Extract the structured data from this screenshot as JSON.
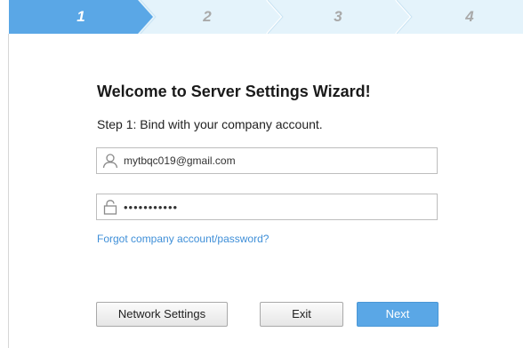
{
  "wizard": {
    "steps": [
      {
        "label": "1",
        "active": true
      },
      {
        "label": "2",
        "active": false
      },
      {
        "label": "3",
        "active": false
      },
      {
        "label": "4",
        "active": false
      }
    ],
    "colors": {
      "active_step": "#5aa7e6",
      "inactive_step": "#e4f3fb",
      "link": "#3f8fd8",
      "primary_button": "#5aa7e6"
    }
  },
  "content": {
    "title": "Welcome to Server Settings Wizard!",
    "subtitle": "Step 1: Bind with your company account.",
    "email": {
      "value": "mytbqc019@gmail.com",
      "icon": "user-icon"
    },
    "password": {
      "value": "•••••••••••",
      "icon": "lock-icon"
    },
    "forgot_link": "Forgot company account/password?"
  },
  "buttons": {
    "network_settings": "Network Settings",
    "exit": "Exit",
    "next": "Next"
  }
}
